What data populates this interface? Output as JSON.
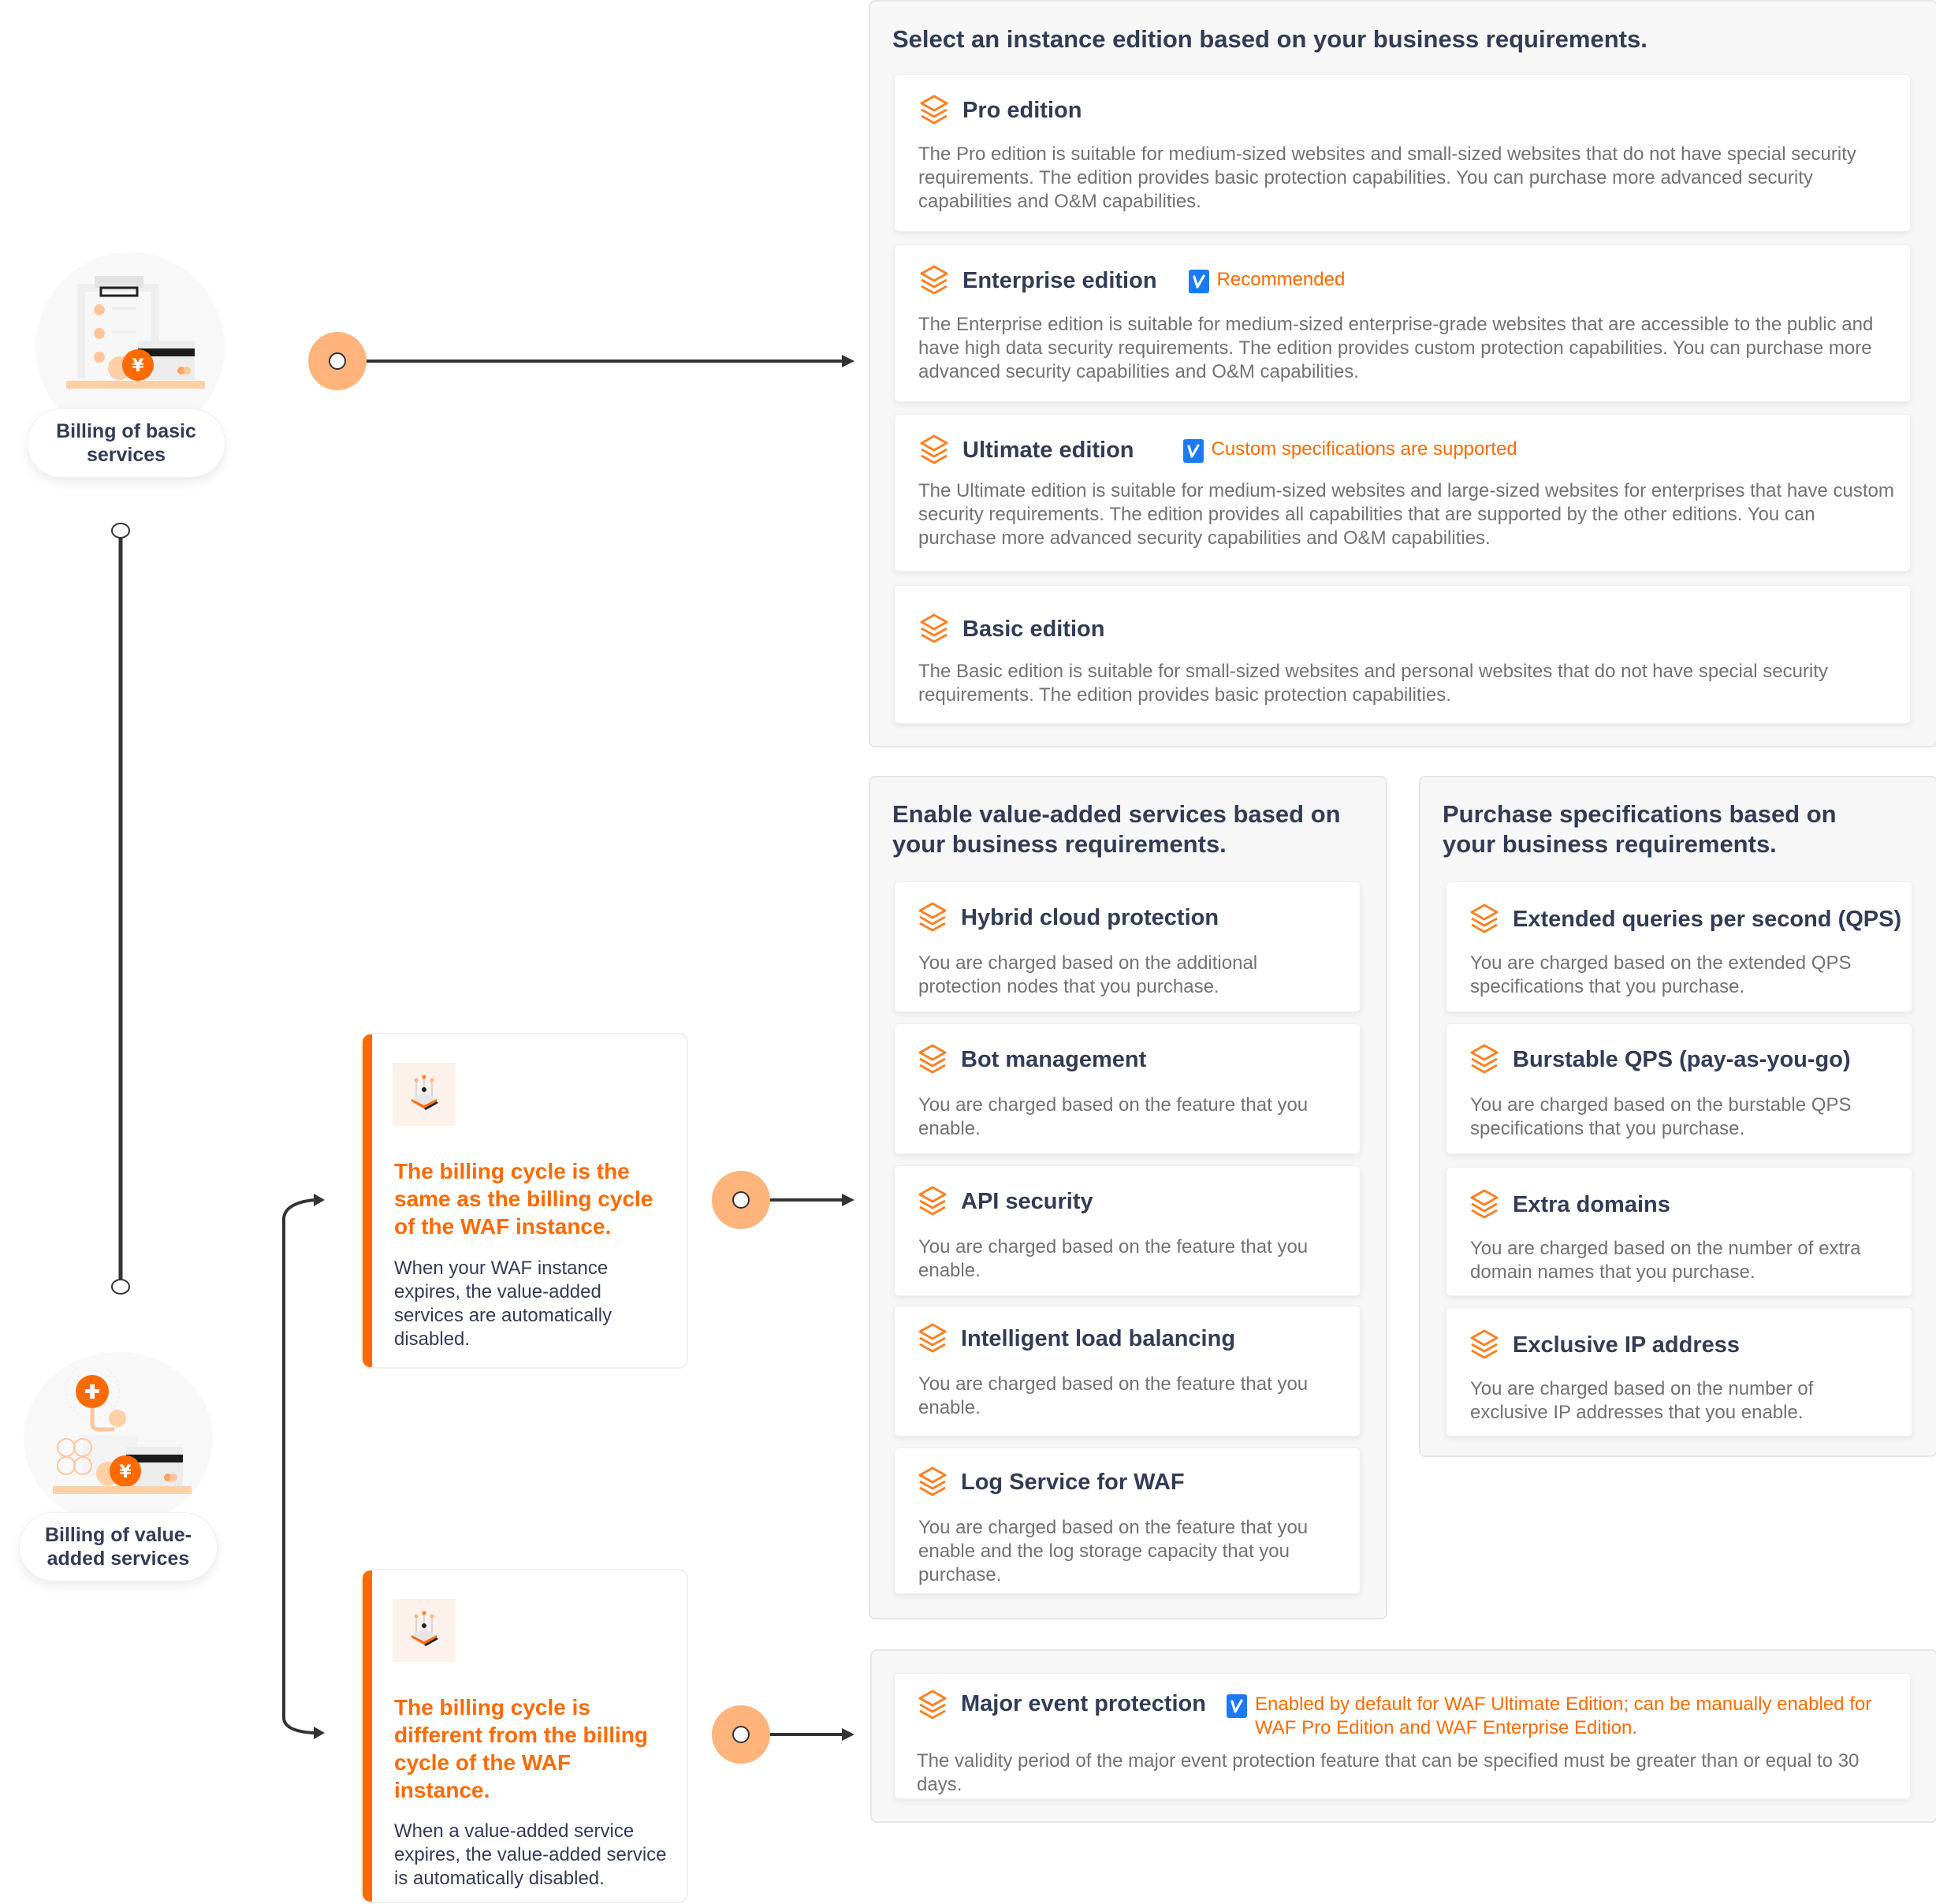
{
  "left": {
    "basic_label": "Billing of basic services",
    "vas_label": "Billing of value-added services",
    "basic_icon": "clipboard-yuan-icon",
    "vas_icon": "plus-yuan-card-icon"
  },
  "cycle_cards": [
    {
      "title": "The billing cycle is the same as the billing cycle of the WAF instance.",
      "desc": "When your WAF instance expires, the value-added services are automatically disabled.",
      "icon": "waf-platform-icon"
    },
    {
      "title": "The billing cycle is different from the billing cycle of the WAF instance.",
      "desc": "When a value-added service expires, the value-added service is automatically disabled.",
      "icon": "waf-platform-icon"
    }
  ],
  "editions": {
    "title": "Select an instance edition based on your business requirements.",
    "items": [
      {
        "name": "Pro edition",
        "tag": "",
        "desc": "The Pro edition is suitable for medium-sized websites and small-sized websites that do not have special security requirements. The edition provides basic protection capabilities. You can purchase more advanced security capabilities and O&M capabilities."
      },
      {
        "name": "Enterprise edition",
        "tag": "Recommended",
        "desc": "The Enterprise edition is suitable for medium-sized enterprise-grade websites that are accessible to the public and have high data security requirements. The edition provides custom protection capabilities. You can purchase more advanced security capabilities and O&M capabilities."
      },
      {
        "name": "Ultimate edition",
        "tag": "Custom specifications are supported",
        "desc": "The Ultimate edition is suitable for medium-sized websites and large-sized websites for enterprises that have custom security requirements. The edition provides all capabilities that are supported by the other editions. You can purchase more advanced security capabilities and O&M capabilities."
      },
      {
        "name": "Basic edition",
        "tag": "",
        "desc": "The Basic edition is suitable for small-sized websites and personal websites that do not have special security requirements. The edition provides basic protection capabilities."
      }
    ]
  },
  "value_added": {
    "title": "Enable value-added services based on your business requirements.",
    "items": [
      {
        "name": "Hybrid cloud protection",
        "desc": "You are charged based on the additional protection nodes that you purchase."
      },
      {
        "name": "Bot management",
        "desc": "You are charged based on the feature that you enable."
      },
      {
        "name": "API security",
        "desc": "You are charged based on the feature that you enable."
      },
      {
        "name": "Intelligent load balancing",
        "desc": "You are charged based on the feature that you enable."
      },
      {
        "name": "Log Service for WAF",
        "desc": "You are charged based on the feature that you enable and the log storage capacity that you purchase."
      }
    ]
  },
  "specifications": {
    "title": "Purchase specifications based on your business requirements.",
    "items": [
      {
        "name": "Extended queries per second (QPS)",
        "desc": "You are charged based on the extended QPS specifications that you purchase."
      },
      {
        "name": "Burstable QPS (pay-as-you-go)",
        "desc": "You are charged based on the burstable QPS specifications that you purchase."
      },
      {
        "name": "Extra domains",
        "desc": "You are charged based on the number of extra domain names that you purchase."
      },
      {
        "name": "Exclusive IP address",
        "desc": "You are charged based on the number of exclusive IP addresses that you enable."
      }
    ]
  },
  "major_event": {
    "name": "Major event protection",
    "tag": "Enabled by default for WAF Ultimate Edition; can be manually enabled for WAF Pro Edition and WAF Enterprise Edition.",
    "desc": "The validity period of the major event protection feature that can be specified must be greater than or equal to 30 days."
  },
  "colors": {
    "accent": "#ff6a00",
    "node": "#ffb47c",
    "check_badge": "#1a7af8",
    "text_dark": "#333c55",
    "text_muted": "#727272"
  }
}
